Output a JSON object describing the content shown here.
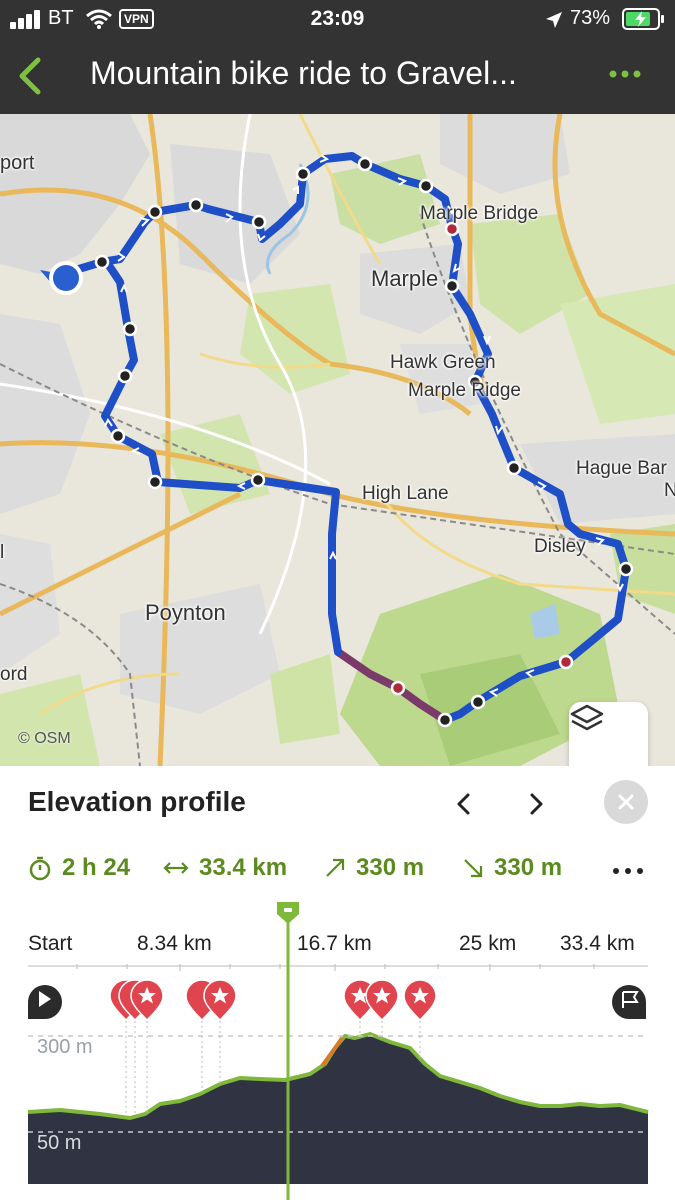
{
  "status": {
    "carrier": "BT",
    "vpn": "VPN",
    "time": "23:09",
    "battery": "73%"
  },
  "nav": {
    "title": "Mountain bike ride to Gravel..."
  },
  "map": {
    "labels": {
      "port": "port",
      "maple_bridge": "Marple Bridge",
      "marple": "Marple",
      "hawk_green": "Hawk Green",
      "marple_ridge": "Marple Ridge",
      "hague_bar": "Hague Bar",
      "high_lane": "High Lane",
      "disley": "Disley",
      "poynton": "Poynton",
      "ord": "ord",
      "l": "l",
      "n": "N"
    },
    "attribution": "© OSM",
    "route_color": "#1f4fc7",
    "steep_color": "#7a3a6a"
  },
  "sheet": {
    "title": "Elevation profile",
    "stats": {
      "duration": "2 h 24",
      "distance": "33.4 km",
      "ascent": "330 m",
      "descent": "330 m"
    },
    "scale": [
      "Start",
      "8.34 km",
      "16.7 km",
      "25 km",
      "33.4 km"
    ],
    "elevation_labels": {
      "high": "300 m",
      "low": "50 m"
    }
  },
  "colors": {
    "accent": "#6ab023",
    "profile_fill": "#303442",
    "profile_line": "#7fb83a",
    "poi": "#e0454f"
  }
}
